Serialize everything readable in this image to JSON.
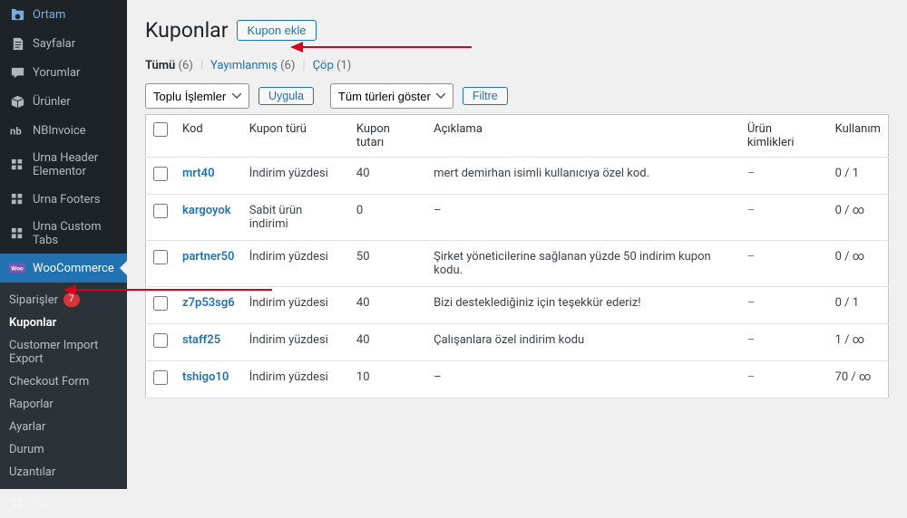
{
  "sidebar": {
    "before": [
      {
        "label": "Ortam",
        "icon": "media"
      },
      {
        "label": "Sayfalar",
        "icon": "page"
      },
      {
        "label": "Yorumlar",
        "icon": "comment"
      },
      {
        "label": "Ürünler",
        "icon": "box"
      },
      {
        "label": "NBInvoice",
        "icon": "nb"
      },
      {
        "label": "Urna Header Elementor",
        "icon": "grid"
      },
      {
        "label": "Urna Footers",
        "icon": "grid"
      },
      {
        "label": "Urna Custom Tabs",
        "icon": "grid"
      }
    ],
    "active": {
      "label": "WooCommerce",
      "icon": "woo"
    },
    "submenu": [
      {
        "label": "Siparişler",
        "badge": "7"
      },
      {
        "label": "Kuponlar",
        "active": true
      },
      {
        "label": "Customer Import Export"
      },
      {
        "label": "Checkout Form"
      },
      {
        "label": "Raporlar"
      },
      {
        "label": "Ayarlar"
      },
      {
        "label": "Durum"
      },
      {
        "label": "Uzantılar"
      }
    ],
    "after": [
      {
        "label": "Pano",
        "icon": "grid"
      }
    ]
  },
  "page": {
    "title": "Kuponlar",
    "add_button": "Kupon ekle"
  },
  "filters": {
    "views": [
      {
        "label": "Tümü",
        "count": "(6)",
        "current": true
      },
      {
        "label": "Yayımlanmış",
        "count": "(6)"
      },
      {
        "label": "Çöp",
        "count": "(1)"
      }
    ],
    "bulk_select": "Toplu İşlemler",
    "apply": "Uygula",
    "type_select": "Tüm türleri göster",
    "filter": "Filtre"
  },
  "table": {
    "headers": {
      "code": "Kod",
      "type": "Kupon türü",
      "amount": "Kupon tutarı",
      "desc": "Açıklama",
      "product_ids": "Ürün kimlikleri",
      "usage": "Kullanım"
    },
    "rows": [
      {
        "code": "mrt40",
        "type": "İndirim yüzdesi",
        "amount": "40",
        "desc": "mert demirhan isimli kullanıcıya özel kod.",
        "product_ids": "–",
        "usage": "0 / 1"
      },
      {
        "code": "kargoyok",
        "type": "Sabit ürün indirimi",
        "amount": "0",
        "desc": "–",
        "product_ids": "–",
        "usage": "0 / ∞"
      },
      {
        "code": "partner50",
        "type": "İndirim yüzdesi",
        "amount": "50",
        "desc": "Şirket yöneticilerine sağlanan yüzde 50 indirim kupon kodu.",
        "product_ids": "–",
        "usage": "0 / ∞"
      },
      {
        "code": "z7p53sg6",
        "type": "İndirim yüzdesi",
        "amount": "40",
        "desc": "Bizi desteklediğiniz için teşekkür ederiz!",
        "product_ids": "–",
        "usage": "0 / 1"
      },
      {
        "code": "staff25",
        "type": "İndirim yüzdesi",
        "amount": "40",
        "desc": "Çalışanlara özel indirim kodu",
        "product_ids": "–",
        "usage": "1 / ∞"
      },
      {
        "code": "tshigo10",
        "type": "İndirim yüzdesi",
        "amount": "10",
        "desc": "–",
        "product_ids": "–",
        "usage": "70 / ∞"
      }
    ]
  }
}
